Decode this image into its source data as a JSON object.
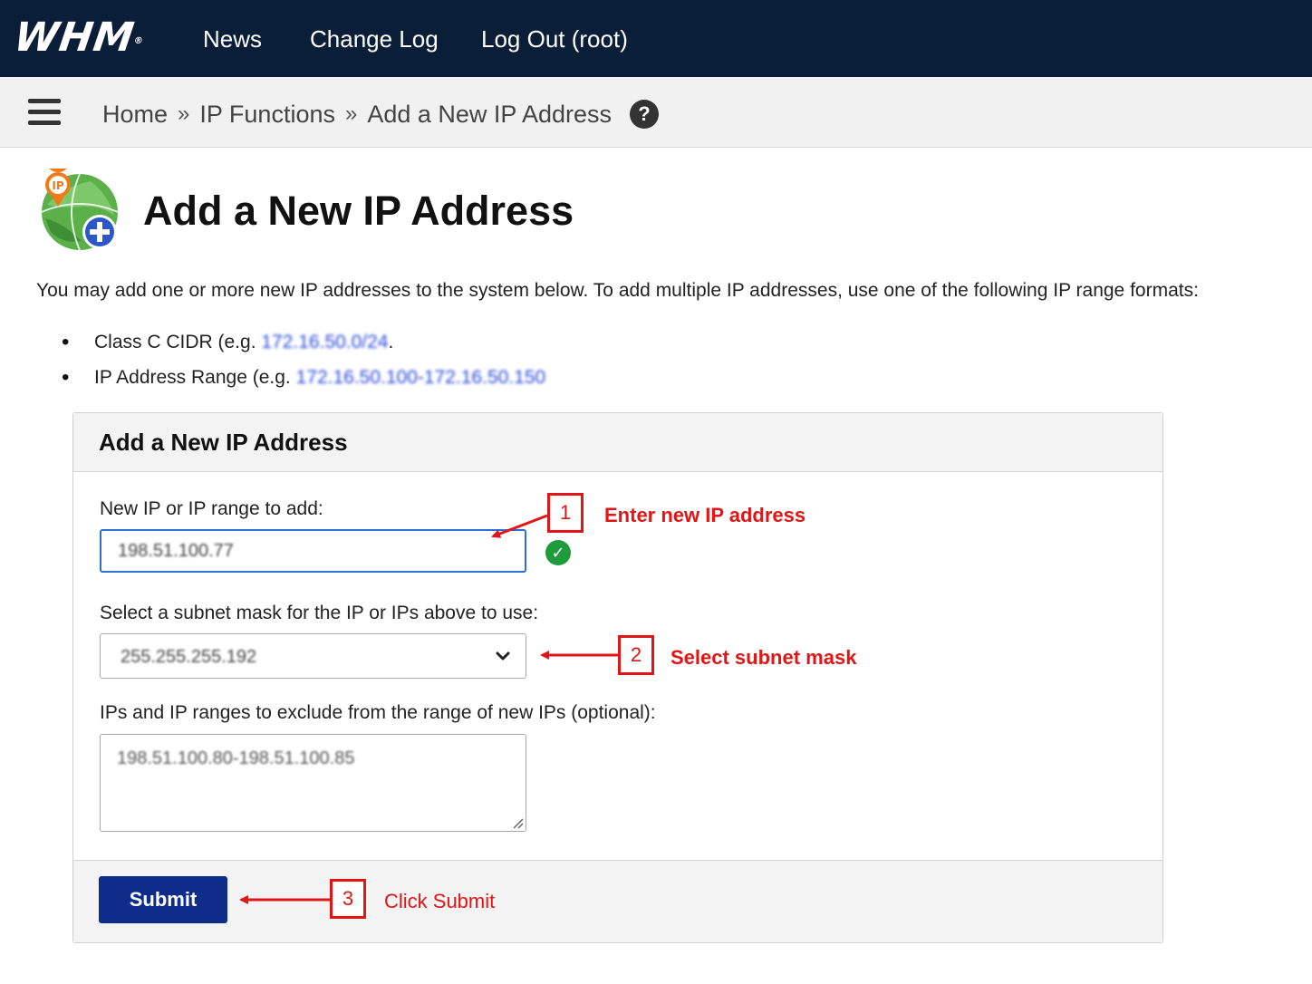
{
  "topnav": {
    "logo": "WHM",
    "links": [
      "News",
      "Change Log",
      "Log Out (root)"
    ]
  },
  "breadcrumb": {
    "items": [
      "Home",
      "IP Functions",
      "Add a New IP Address"
    ],
    "separator": "»",
    "help_glyph": "?"
  },
  "page": {
    "title": "Add a New IP Address",
    "intro": "You may add one or more new IP addresses to the system below. To add multiple IP addresses, use one of the following IP range formats:",
    "formats": [
      {
        "label": "Class C CIDR (e.g.",
        "example": "172.16.50.0/24",
        "suffix": "."
      },
      {
        "label": "IP Address Range (e.g.",
        "example": "172.16.50.100-172.16.50.150",
        "suffix": ""
      }
    ]
  },
  "form": {
    "panel_title": "Add a New IP Address",
    "ip_label": "New IP or IP range to add:",
    "ip_value": "198.51.100.77",
    "subnet_label": "Select a subnet mask for the IP or IPs above to use:",
    "subnet_value": "255.255.255.192",
    "exclude_label": "IPs and IP ranges to exclude from the range of new IPs (optional):",
    "exclude_value": "198.51.100.80-198.51.100.85",
    "submit_label": "Submit"
  },
  "annotations": [
    {
      "num": "1",
      "text": "Enter new IP address"
    },
    {
      "num": "2",
      "text": "Select subnet mask"
    },
    {
      "num": "3",
      "text": "Click Submit"
    }
  ],
  "colors": {
    "nav_bg": "#0b1e38",
    "accent_blue": "#0e2d8a",
    "annotation_red": "#e01616",
    "success_green": "#1e9b3a"
  },
  "icons": [
    "hamburger-menu-icon",
    "help-icon",
    "ip-globe-add-icon",
    "checkmark-icon",
    "chevron-down-icon",
    "resize-grip-icon"
  ]
}
